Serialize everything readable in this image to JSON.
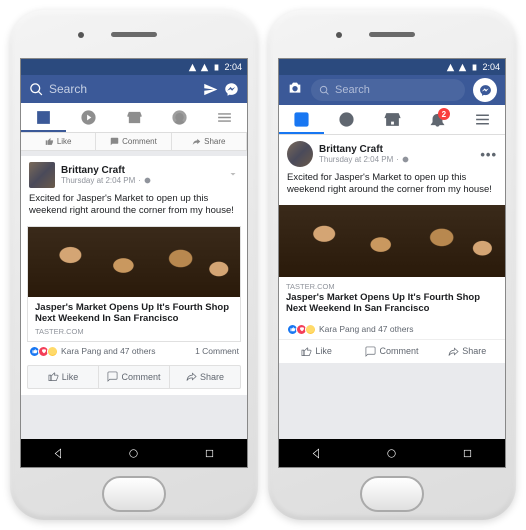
{
  "status": {
    "time": "2:04"
  },
  "header": {
    "search_placeholder": "Search",
    "notif_count": "2"
  },
  "post": {
    "author": "Brittany Craft",
    "timestamp": "Thursday at 2:04 PM",
    "body": "Excited for Jasper's Market to open up this weekend right around the corner from my house!",
    "link_headline": "Jasper's Market Opens Up It's Fourth Shop Next Weekend In San Francisco",
    "link_source": "TASTER.COM",
    "reactions_text": "Kara Pang and 47 others",
    "comments_text": "1 Comment"
  },
  "cutbar": {
    "like": "Like",
    "comment": "Comment",
    "share": "Share"
  },
  "actions": {
    "like": "Like",
    "comment": "Comment",
    "share": "Share"
  }
}
